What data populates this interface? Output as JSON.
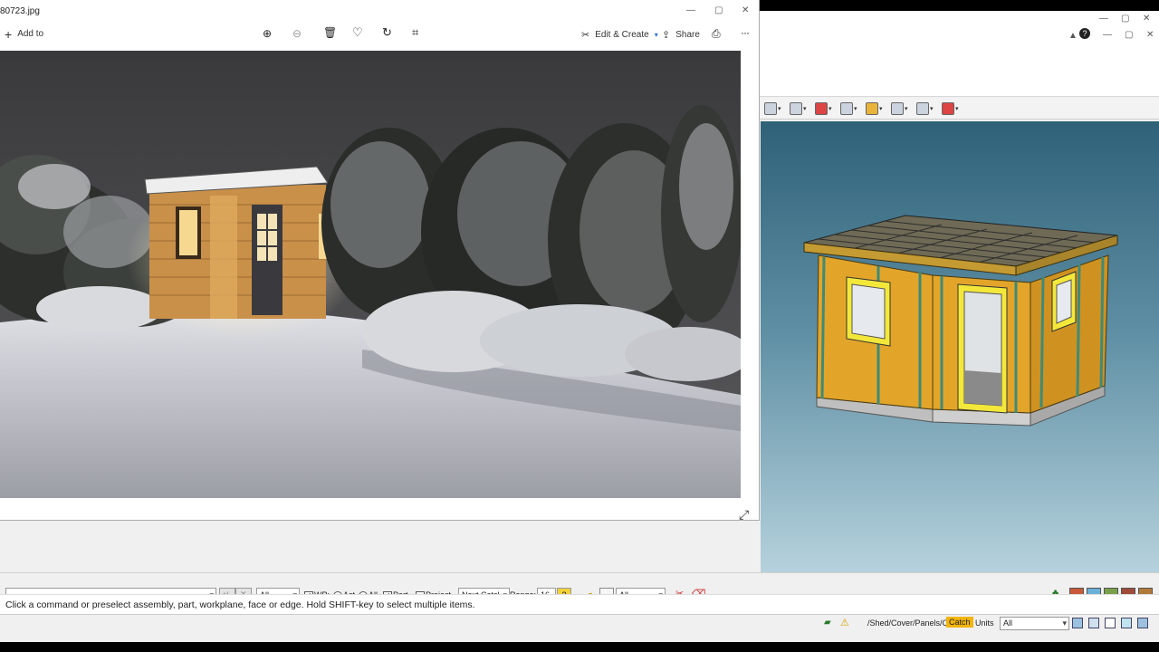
{
  "photos_window": {
    "title": "80723.jpg",
    "add_to_label": "Add to",
    "edit_create_label": "Edit & Create",
    "share_label": "Share",
    "more_label": "···"
  },
  "cad_app": {
    "command_bar": {
      "filter_value": "All",
      "wp_label": "WP:",
      "act_label": "Act",
      "all_label": "All",
      "part_label": "Part",
      "project_label": "Project",
      "next_catch_value": "Next Catcl",
      "range_label": "Range:",
      "range_value": "16",
      "selection_filter_value": "All"
    },
    "message": "Click a command or preselect assembly, part, workplane, face or edge. Hold SHIFT-key to select multiple items.",
    "status_bar": {
      "path": "/Shed/Cover/Panels/OS",
      "catch_label": "Catch",
      "units_label": "Units",
      "units_value": "All"
    }
  },
  "colors": {
    "accent_catch": "#f2b40c",
    "viewport_top": "#2f6178",
    "viewport_bottom": "#b9d4df"
  }
}
